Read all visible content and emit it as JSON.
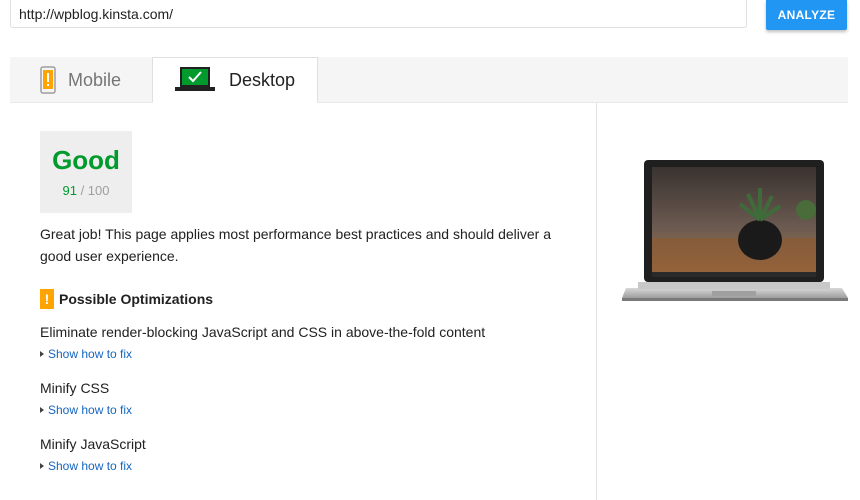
{
  "search": {
    "url_value": "http://wpblog.kinsta.com/",
    "analyze_label": "ANALYZE"
  },
  "tabs": [
    {
      "label": "Mobile",
      "icon": "mobile-warning-icon",
      "active": false
    },
    {
      "label": "Desktop",
      "icon": "desktop-check-icon",
      "active": true
    }
  ],
  "score": {
    "label": "Good",
    "value": "91",
    "max": "/ 100"
  },
  "summary": "Great job! This page applies most performance best practices and should deliver a good user experience.",
  "optimizations": {
    "icon_glyph": "!",
    "title": "Possible Optimizations",
    "items": [
      {
        "title": "Eliminate render-blocking JavaScript and CSS in above-the-fold content",
        "link": "Show how to fix"
      },
      {
        "title": "Minify CSS",
        "link": "Show how to fix"
      },
      {
        "title": "Minify JavaScript",
        "link": "Show how to fix"
      }
    ]
  },
  "colors": {
    "accent": "#2196f3",
    "good": "#009a2d",
    "warning": "#ffa400",
    "link": "#1565c0"
  }
}
